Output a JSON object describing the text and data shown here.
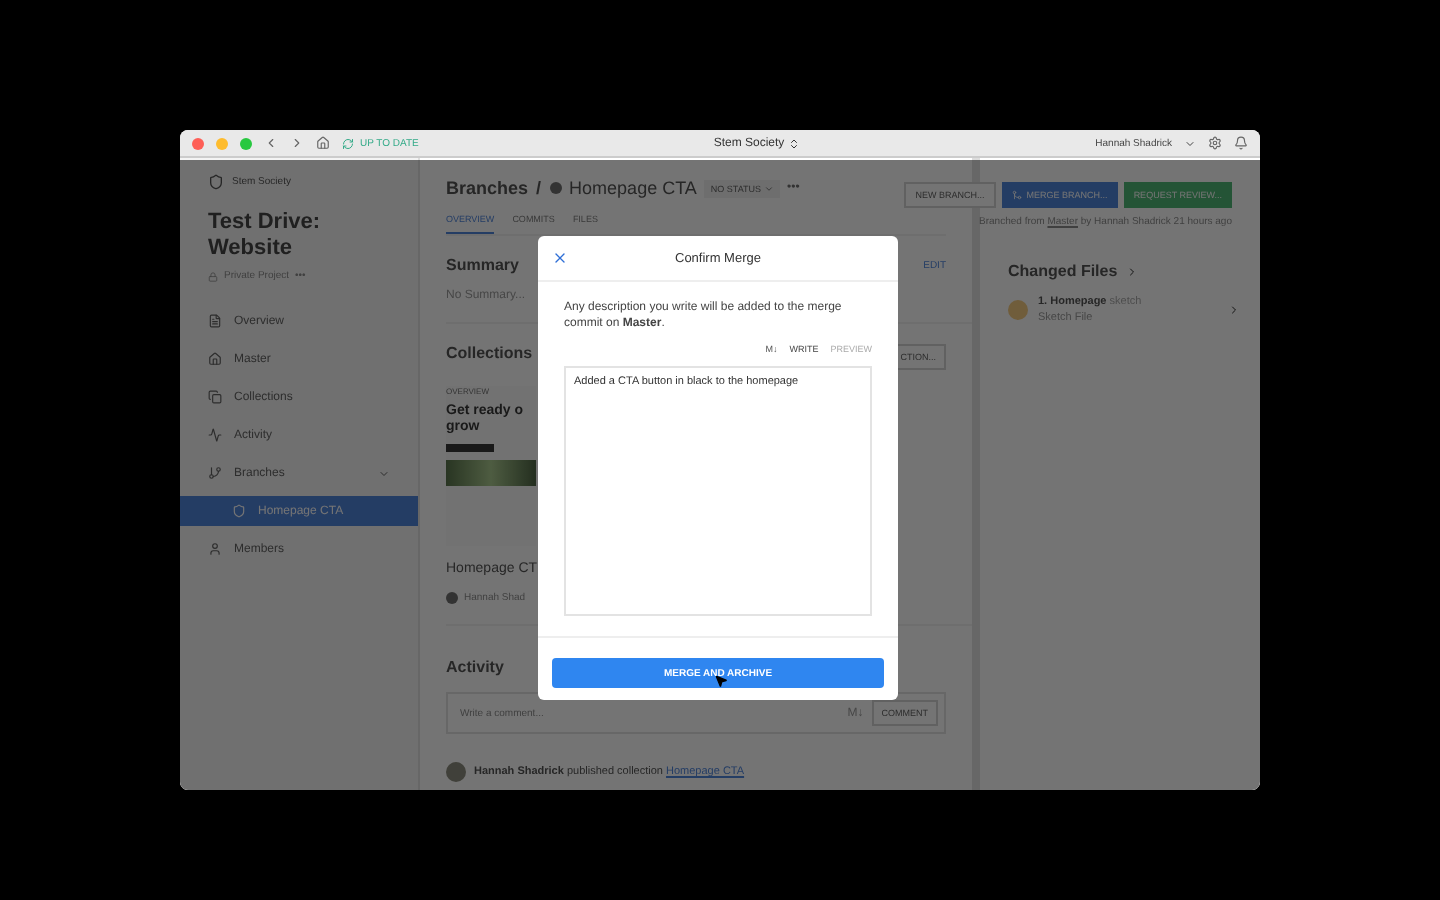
{
  "window": {
    "sync_status": "UP TO DATE",
    "project_switcher": "Stem Society",
    "user": "Hannah Shadrick"
  },
  "sidebar": {
    "org": "Stem Society",
    "project_title": "Test Drive: Website",
    "visibility": "Private Project",
    "more": "•••",
    "items": [
      {
        "label": "Overview",
        "selected": false
      },
      {
        "label": "Master",
        "selected": false
      },
      {
        "label": "Collections",
        "selected": false
      },
      {
        "label": "Activity",
        "selected": false
      },
      {
        "label": "Branches",
        "selected": false,
        "expanded": true,
        "children": [
          {
            "label": "Homepage CTA",
            "selected": true
          }
        ]
      },
      {
        "label": "Members",
        "selected": false
      }
    ]
  },
  "header": {
    "breadcrumb": "Branches",
    "separator": "/",
    "branch": "Homepage CTA",
    "status": "NO STATUS",
    "more": "•••",
    "buttons": [
      {
        "label": "NEW BRANCH...",
        "kind": "outline"
      },
      {
        "label": "MERGE BRANCH...",
        "kind": "primary"
      },
      {
        "label": "REQUEST REVIEW...",
        "kind": "success"
      }
    ],
    "tabs": [
      {
        "label": "OVERVIEW",
        "selected": true
      },
      {
        "label": "COMMITS",
        "selected": false
      },
      {
        "label": "FILES",
        "selected": false
      }
    ],
    "branched_info": {
      "before": "Branched from",
      "link": "Master",
      "after": "by Hannah Shadrick 21 hours ago"
    }
  },
  "summary": {
    "title": "Summary",
    "edit": "EDIT",
    "text": "No Summary..."
  },
  "collections": {
    "title": "Collections",
    "add_button": "CTION...",
    "card": {
      "thumb_label": "OVERVIEW",
      "thumb_text": "Get ready o grow",
      "name": "Homepage CT",
      "author": "Hannah Shad"
    }
  },
  "activity": {
    "title": "Activity",
    "comment_placeholder": "Write a comment...",
    "markdown": "M↓",
    "comment_button": "COMMENT",
    "entries": [
      {
        "user": "Hannah Shadrick",
        "action": "published collection",
        "link": "Homepage CTA"
      }
    ]
  },
  "changed_files": {
    "title": "Changed Files",
    "files": [
      {
        "name": "1. Homepage",
        "ext": "sketch",
        "type": "Sketch File"
      }
    ]
  },
  "modal": {
    "title": "Confirm Merge",
    "description": "Any description you write will be added to the merge commit on **Master**.",
    "markdown": "M↓",
    "tabs": [
      {
        "label": "WRITE",
        "selected": true
      },
      {
        "label": "PREVIEW",
        "selected": false
      }
    ],
    "value": "Added a CTA button in black to the homepage",
    "button": "MERGE AND ARCHIVE"
  }
}
